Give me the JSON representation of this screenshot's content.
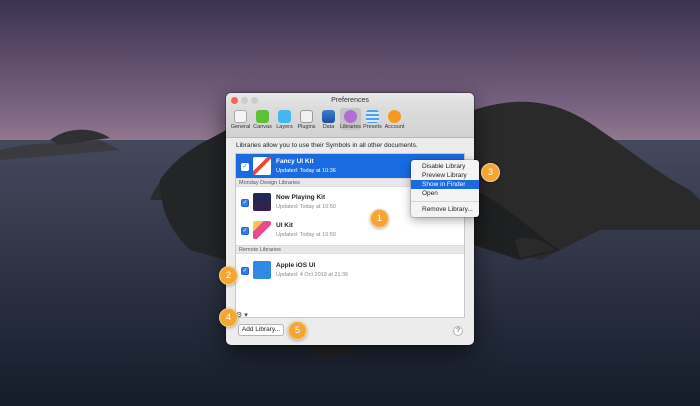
{
  "window": {
    "title": "Preferences"
  },
  "toolbar": {
    "items": [
      {
        "label": "General",
        "icon": "phone-icon"
      },
      {
        "label": "Canvas",
        "icon": "canvas-icon"
      },
      {
        "label": "Layers",
        "icon": "layers-icon"
      },
      {
        "label": "Plugins",
        "icon": "plug-icon"
      },
      {
        "label": "Data",
        "icon": "data-icon"
      },
      {
        "label": "Libraries",
        "icon": "link-icon"
      },
      {
        "label": "Presets",
        "icon": "presets-icon"
      },
      {
        "label": "Account",
        "icon": "account-icon"
      }
    ]
  },
  "description": "Libraries allow you to use their Symbols in all other documents.",
  "libraries": {
    "selected": {
      "name": "Fancy UI Kit",
      "updated": "Updated: Today at 10:36"
    },
    "section_monday": "Monday Design Libraries",
    "monday_items": [
      {
        "name": "Now Playing Kit",
        "updated": "Updated: Today at 10:50"
      },
      {
        "name": "UI Kit",
        "updated": "Updated: Today at 10:50"
      }
    ],
    "section_remote": "Remote Libraries",
    "remote_items": [
      {
        "name": "Apple iOS UI",
        "updated": "Updated: 4 Oct 2019 at 21:36"
      }
    ]
  },
  "footer": {
    "gear_symbol": "⚙ ▾",
    "add_label": "Add Library...",
    "help_label": "?"
  },
  "context_menu": {
    "items": [
      "Disable Library",
      "Preview Library",
      "Show in Finder",
      "Open"
    ],
    "highlighted": "Show in Finder",
    "remove": "Remove Library..."
  },
  "badges": [
    "1",
    "2",
    "3",
    "4",
    "5"
  ],
  "colors": {
    "accent": "#1a6ae0",
    "badge": "#f3a635"
  }
}
